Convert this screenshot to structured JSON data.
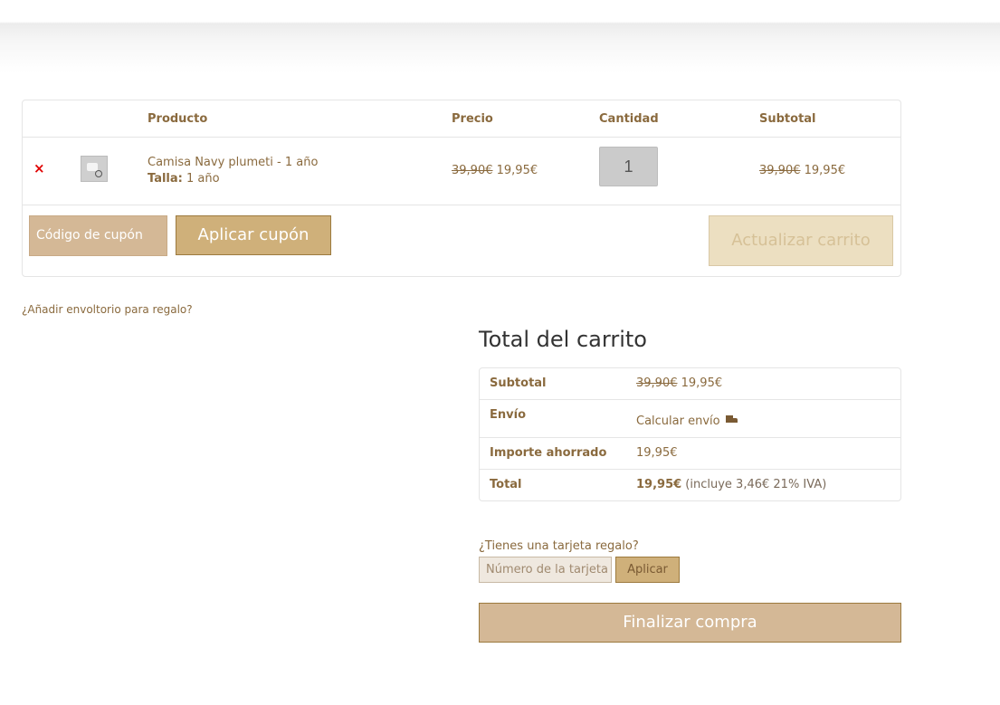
{
  "cart": {
    "headers": {
      "product": "Producto",
      "price": "Precio",
      "quantity": "Cantidad",
      "subtotal": "Subtotal"
    },
    "items": [
      {
        "remove": "×",
        "name": "Camisa Navy plumeti - 1 año",
        "attr_label": "Talla:",
        "attr_value": " 1 año",
        "price_old": "39,90€",
        "price_new": " 19,95€",
        "quantity": "1",
        "subtotal_old": "39,90€",
        "subtotal_new": " 19,95€"
      }
    ],
    "coupon_placeholder": "Código de cupón",
    "apply_coupon": "Aplicar cupón",
    "update_cart": "Actualizar carrito"
  },
  "gift_wrap_link": "¿Añadir envoltorio para regalo?",
  "totals": {
    "title": "Total del carrito",
    "subtotal_label": "Subtotal",
    "subtotal_old": "39,90€",
    "subtotal_new": " 19,95€",
    "shipping_label": "Envío",
    "shipping_link": "Calcular envío",
    "shipping_icon": "truck-icon",
    "saved_label": "Importe ahorrado",
    "saved_value": "19,95€",
    "total_label": "Total",
    "total_value": "19,95€",
    "total_tax": " (incluye 3,46€ 21% IVA)"
  },
  "giftcard": {
    "question": "¿Tienes una tarjeta regalo?",
    "placeholder": "Número de la tarjeta r",
    "apply": "Aplicar"
  },
  "checkout_label": "Finalizar compra",
  "colors": {
    "accent": "#cfb07a",
    "accent_light": "#d4b896",
    "text": "#8a6a3e",
    "remove": "#e00000"
  }
}
